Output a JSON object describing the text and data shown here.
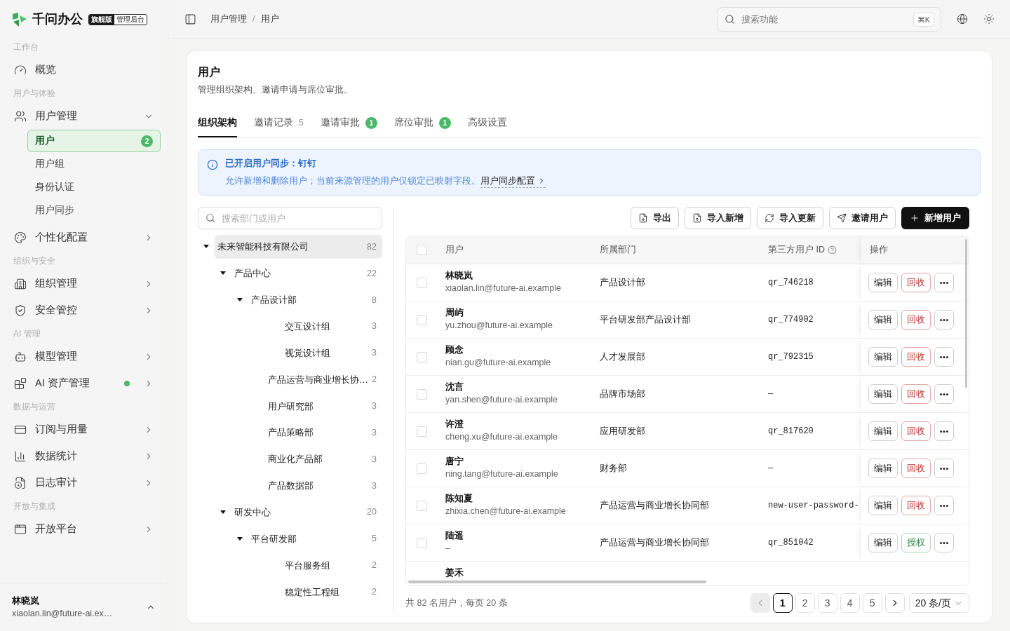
{
  "brand": {
    "name": "千问办公",
    "edition": "旗舰版",
    "console": "管理后台"
  },
  "sidebar": {
    "sections": [
      {
        "label": "工作台",
        "items": [
          {
            "label": "概览"
          }
        ]
      },
      {
        "label": "用户与体验",
        "items": [
          {
            "label": "用户管理",
            "expanded": true,
            "children": [
              {
                "label": "用户",
                "selected": true,
                "badge": "2"
              },
              {
                "label": "用户组",
                "selected": false
              },
              {
                "label": "身份认证",
                "selected": false
              },
              {
                "label": "用户同步",
                "selected": false
              }
            ]
          },
          {
            "label": "个性化配置",
            "expanded": false
          }
        ]
      },
      {
        "label": "组织与安全",
        "items": [
          {
            "label": "组织管理",
            "expanded": false
          },
          {
            "label": "安全管控",
            "expanded": false
          }
        ]
      },
      {
        "label": "AI 管理",
        "items": [
          {
            "label": "模型管理",
            "expanded": false
          },
          {
            "label": "AI 资产管理",
            "expanded": false,
            "status_dot": true
          }
        ]
      },
      {
        "label": "数据与运营",
        "items": [
          {
            "label": "订阅与用量",
            "expanded": false
          },
          {
            "label": "数据统计",
            "expanded": false
          },
          {
            "label": "日志审计",
            "expanded": false
          }
        ]
      },
      {
        "label": "开放与集成",
        "items": [
          {
            "label": "开放平台",
            "expanded": false
          }
        ]
      }
    ],
    "user": {
      "name": "林晓岚",
      "email": "xiaolan.lin@future-ai.ex…"
    }
  },
  "header": {
    "breadcrumb": [
      "用户管理",
      "用户"
    ],
    "breadcrumb_separator": "/",
    "search": {
      "placeholder": "搜索功能",
      "shortcut": "⌘K"
    }
  },
  "page": {
    "title": "用户",
    "subtitle": "管理组织架构、邀请申请与席位审批。"
  },
  "tabs": [
    {
      "label": "组织架构",
      "selected": true
    },
    {
      "label": "邀请记录",
      "count": "5",
      "selected": false
    },
    {
      "label": "邀请审批",
      "badge": "1",
      "selected": false
    },
    {
      "label": "席位审批",
      "badge": "1",
      "selected": false
    },
    {
      "label": "高级设置",
      "selected": false
    }
  ],
  "alert": {
    "title": "已开启用户同步：钉钉",
    "text": "允许新增和删除用户；当前来源管理的用户仅锁定已映射字段。",
    "link": "用户同步配置"
  },
  "tree": {
    "search": {
      "placeholder": "搜索部门或用户"
    },
    "nodes": [
      {
        "label": "未来智能科技有限公司",
        "count": "82",
        "selected": true,
        "expanded": true,
        "children": [
          {
            "label": "产品中心",
            "count": "22",
            "selected": false,
            "expanded": true,
            "children": [
              {
                "label": "产品设计部",
                "count": "8",
                "selected": false,
                "expanded": true,
                "children": [
                  {
                    "label": "交互设计组",
                    "count": "3",
                    "selected": false
                  },
                  {
                    "label": "视觉设计组",
                    "count": "3",
                    "selected": false
                  }
                ]
              },
              {
                "label": "产品运营与商业增长协…",
                "count": "2",
                "selected": false
              },
              {
                "label": "用户研究部",
                "count": "3",
                "selected": false
              },
              {
                "label": "产品策略部",
                "count": "3",
                "selected": false
              },
              {
                "label": "商业化产品部",
                "count": "3",
                "selected": false
              },
              {
                "label": "产品数据部",
                "count": "3",
                "selected": false
              }
            ]
          },
          {
            "label": "研发中心",
            "count": "20",
            "selected": false,
            "expanded": true,
            "children": [
              {
                "label": "平台研发部",
                "count": "5",
                "selected": false,
                "expanded": true,
                "children": [
                  {
                    "label": "平台服务组",
                    "count": "2",
                    "selected": false
                  },
                  {
                    "label": "稳定性工程组",
                    "count": "2",
                    "selected": false
                  }
                ]
              }
            ]
          }
        ]
      }
    ]
  },
  "toolbar": [
    {
      "label": "导出",
      "kind": "default"
    },
    {
      "label": "导入新增",
      "kind": "default"
    },
    {
      "label": "导入更新",
      "kind": "default"
    },
    {
      "label": "邀请用户",
      "kind": "default"
    },
    {
      "label": "新增用户",
      "kind": "primary"
    }
  ],
  "table": {
    "select_all_checked": false,
    "columns": [
      "用户",
      "所属部门",
      "第三方用户 ID",
      "操作"
    ],
    "rows": [
      {
        "name": "林晓岚",
        "email": "xiaolan.lin@future-ai.example",
        "department": "产品设计部",
        "third_party_id": "qr_746218",
        "checked": false,
        "actions": [
          {
            "label": "编辑",
            "kind": "default"
          },
          {
            "label": "回收",
            "kind": "danger"
          }
        ]
      },
      {
        "name": "周屿",
        "email": "yu.zhou@future-ai.example",
        "department": "平台研发部产品设计部",
        "third_party_id": "qr_774902",
        "checked": false,
        "actions": [
          {
            "label": "编辑",
            "kind": "default"
          },
          {
            "label": "回收",
            "kind": "danger"
          }
        ]
      },
      {
        "name": "顾念",
        "email": "nian.gu@future-ai.example",
        "department": "人才发展部",
        "third_party_id": "qr_792315",
        "checked": false,
        "actions": [
          {
            "label": "编辑",
            "kind": "default"
          },
          {
            "label": "回收",
            "kind": "danger"
          }
        ]
      },
      {
        "name": "沈言",
        "email": "yan.shen@future-ai.example",
        "department": "品牌市场部",
        "third_party_id": "—",
        "checked": false,
        "actions": [
          {
            "label": "编辑",
            "kind": "default"
          },
          {
            "label": "回收",
            "kind": "danger"
          }
        ]
      },
      {
        "name": "许澄",
        "email": "cheng.xu@future-ai.example",
        "department": "应用研发部",
        "third_party_id": "qr_817620",
        "checked": false,
        "actions": [
          {
            "label": "编辑",
            "kind": "default"
          },
          {
            "label": "回收",
            "kind": "danger"
          }
        ]
      },
      {
        "name": "唐宁",
        "email": "ning.tang@future-ai.example",
        "department": "财务部",
        "third_party_id": "—",
        "checked": false,
        "actions": [
          {
            "label": "编辑",
            "kind": "default"
          },
          {
            "label": "回收",
            "kind": "danger"
          }
        ]
      },
      {
        "name": "陈知夏",
        "email": "zhixia.chen@future-ai.example",
        "department": "产品运营与商业增长协同部",
        "third_party_id": "new-user-password-",
        "checked": false,
        "actions": [
          {
            "label": "编辑",
            "kind": "default"
          },
          {
            "label": "回收",
            "kind": "danger"
          }
        ]
      },
      {
        "name": "陆遥",
        "email": "–",
        "department": "产品运营与商业增长协同部",
        "third_party_id": "qr_851042",
        "checked": false,
        "actions": [
          {
            "label": "编辑",
            "kind": "default"
          },
          {
            "label": "授权",
            "kind": "grant"
          }
        ]
      },
      {
        "name": "姜禾"
      }
    ]
  },
  "pagination": {
    "summary": "共 82 名用户，每页 20 条",
    "prev_disabled": true,
    "next_disabled": false,
    "pages": [
      {
        "label": "1",
        "selected": true
      },
      {
        "label": "2",
        "selected": false
      },
      {
        "label": "3",
        "selected": false
      },
      {
        "label": "4",
        "selected": false
      },
      {
        "label": "5",
        "selected": false
      }
    ],
    "page_size": "20 条/页"
  }
}
